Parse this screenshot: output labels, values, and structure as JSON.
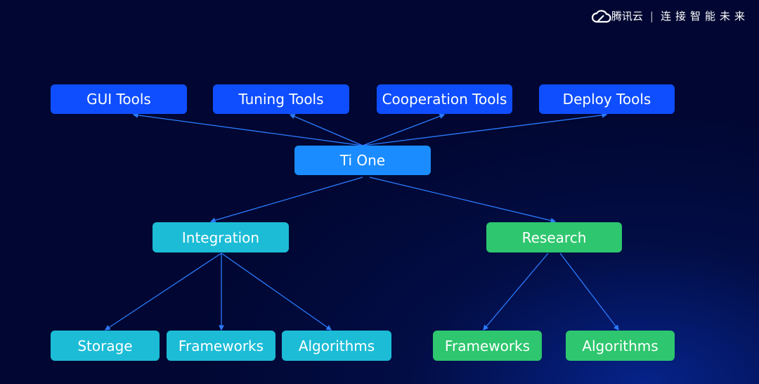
{
  "brand": {
    "logo_icon": "cloud-icon",
    "name": "腾讯云",
    "separator": "|",
    "slogan": "连接智能未来"
  },
  "colors": {
    "background": "#010732",
    "tools": "#0f4eff",
    "root": "#1a8cff",
    "integration": "#1cbcd6",
    "research": "#2ec66e",
    "edge": "#2b7bff"
  },
  "diagram": {
    "root": {
      "label": "Ti One"
    },
    "tools": [
      {
        "label": "GUI Tools"
      },
      {
        "label": "Tuning Tools"
      },
      {
        "label": "Cooperation Tools"
      },
      {
        "label": "Deploy Tools"
      }
    ],
    "branches": [
      {
        "label": "Integration",
        "children": [
          {
            "label": "Storage"
          },
          {
            "label": "Frameworks"
          },
          {
            "label": "Algorithms"
          }
        ]
      },
      {
        "label": "Research",
        "children": [
          {
            "label": "Frameworks"
          },
          {
            "label": "Algorithms"
          }
        ]
      }
    ]
  }
}
